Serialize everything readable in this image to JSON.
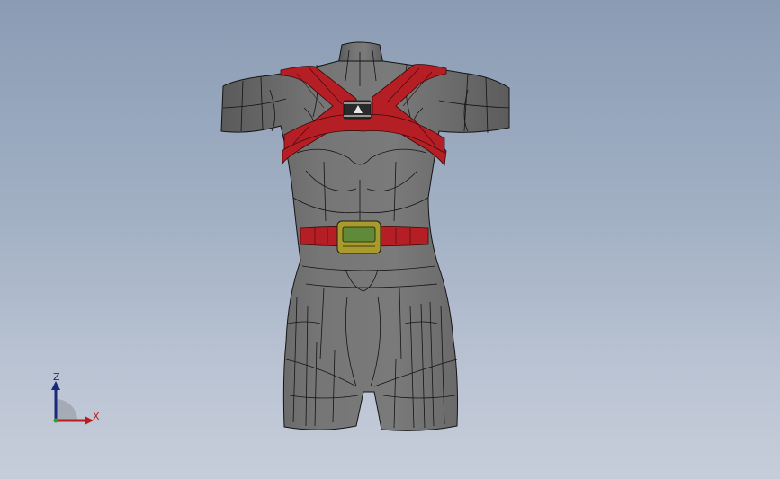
{
  "viewport": {
    "background_top": "#8a9cb4",
    "background_bottom": "#c6cdda"
  },
  "model": {
    "body_color": "#6e6e6e",
    "edge_color": "#141414",
    "strap_color": "#b41e24",
    "device_body_color": "#a89a2c",
    "device_screen_color": "#5e8a3a"
  },
  "triad": {
    "z_label": "Z",
    "x_label": "X",
    "z_color": "#1a2a7a",
    "x_color": "#b81c1c"
  }
}
